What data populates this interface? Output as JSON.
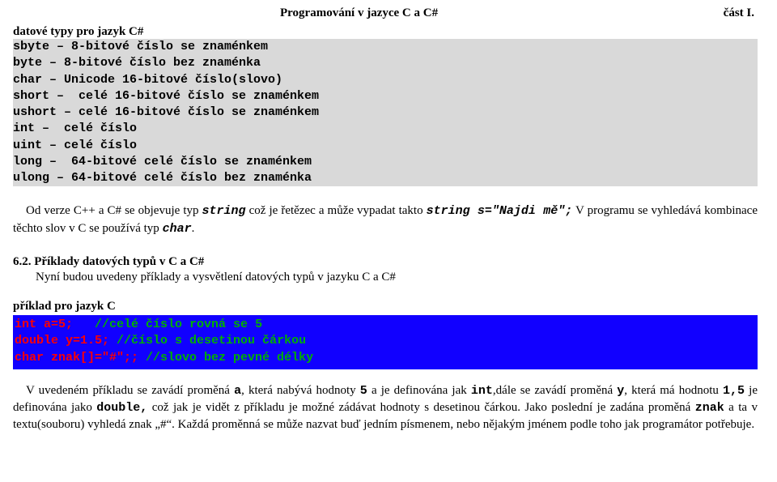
{
  "header": {
    "center": "Programování v jazyce C a C#",
    "right": "část I."
  },
  "section1_title": "datové typy pro jazyk C#",
  "grey_code": [
    "sbyte – 8-bitové číslo se znaménkem",
    "byte – 8-bitové číslo bez znaménka",
    "char – Unicode 16-bitové číslo(slovo)",
    "short –  celé 16-bitové číslo se znaménkem",
    "ushort – celé 16-bitové číslo se znaménkem",
    "int –  celé číslo",
    "uint – celé číslo",
    "long –  64-bitové celé číslo se znaménkem",
    "ulong – 64-bitové celé číslo bez znaménka"
  ],
  "para1": {
    "t1": "Od verze C++ a C# se objevuje typ ",
    "m1": "string",
    "t2": " což je řetězec a může vypadat takto ",
    "m2": "string s=\"Najdi mě\";",
    "t3": " V programu se vyhledává kombinace těchto slov v C se používá typ ",
    "m3": "char",
    "t4": "."
  },
  "subsection": {
    "num_title": "6.2. Příklady datových typů v C a C#",
    "body": "Nyní  budou uvedeny příklady a vysvětlení datových typů v jazyku C a C#"
  },
  "example_title": "příklad pro jazyk C",
  "blue_code": {
    "l1a": "int a=5;   ",
    "l1b": "//celé číslo rovná se 5",
    "l2a": "double y=1.5; ",
    "l2b": "//číslo s desetinou čárkou",
    "l3a": "char znak[]=\"#\";; ",
    "l3b": "//slovo bez pevné délky"
  },
  "final": {
    "t1": "V uvedeném příkladu se zavádí proměná ",
    "m1": "a",
    "t2": ", která nabývá hodnoty ",
    "m2": "5",
    "t3": " a je definována jak ",
    "m3": "int",
    "t4": ",dále se zavádí proměná ",
    "m4": "y",
    "t5": ", která má hodnotu ",
    "m5": "1,5",
    "t6": " je definována jako ",
    "m6": "double,",
    "t7": " což jak je vidět z příkladu je možné zádávat hodnoty s desetinou čárkou. Jako poslední je zadána proměná ",
    "m7": "znak",
    "t8": " a ta v textu(souboru) vyhledá znak  „#“. Každá proměnná se může nazvat buď jedním písmenem, nebo nějakým jménem podle toho jak programátor potřebuje."
  }
}
